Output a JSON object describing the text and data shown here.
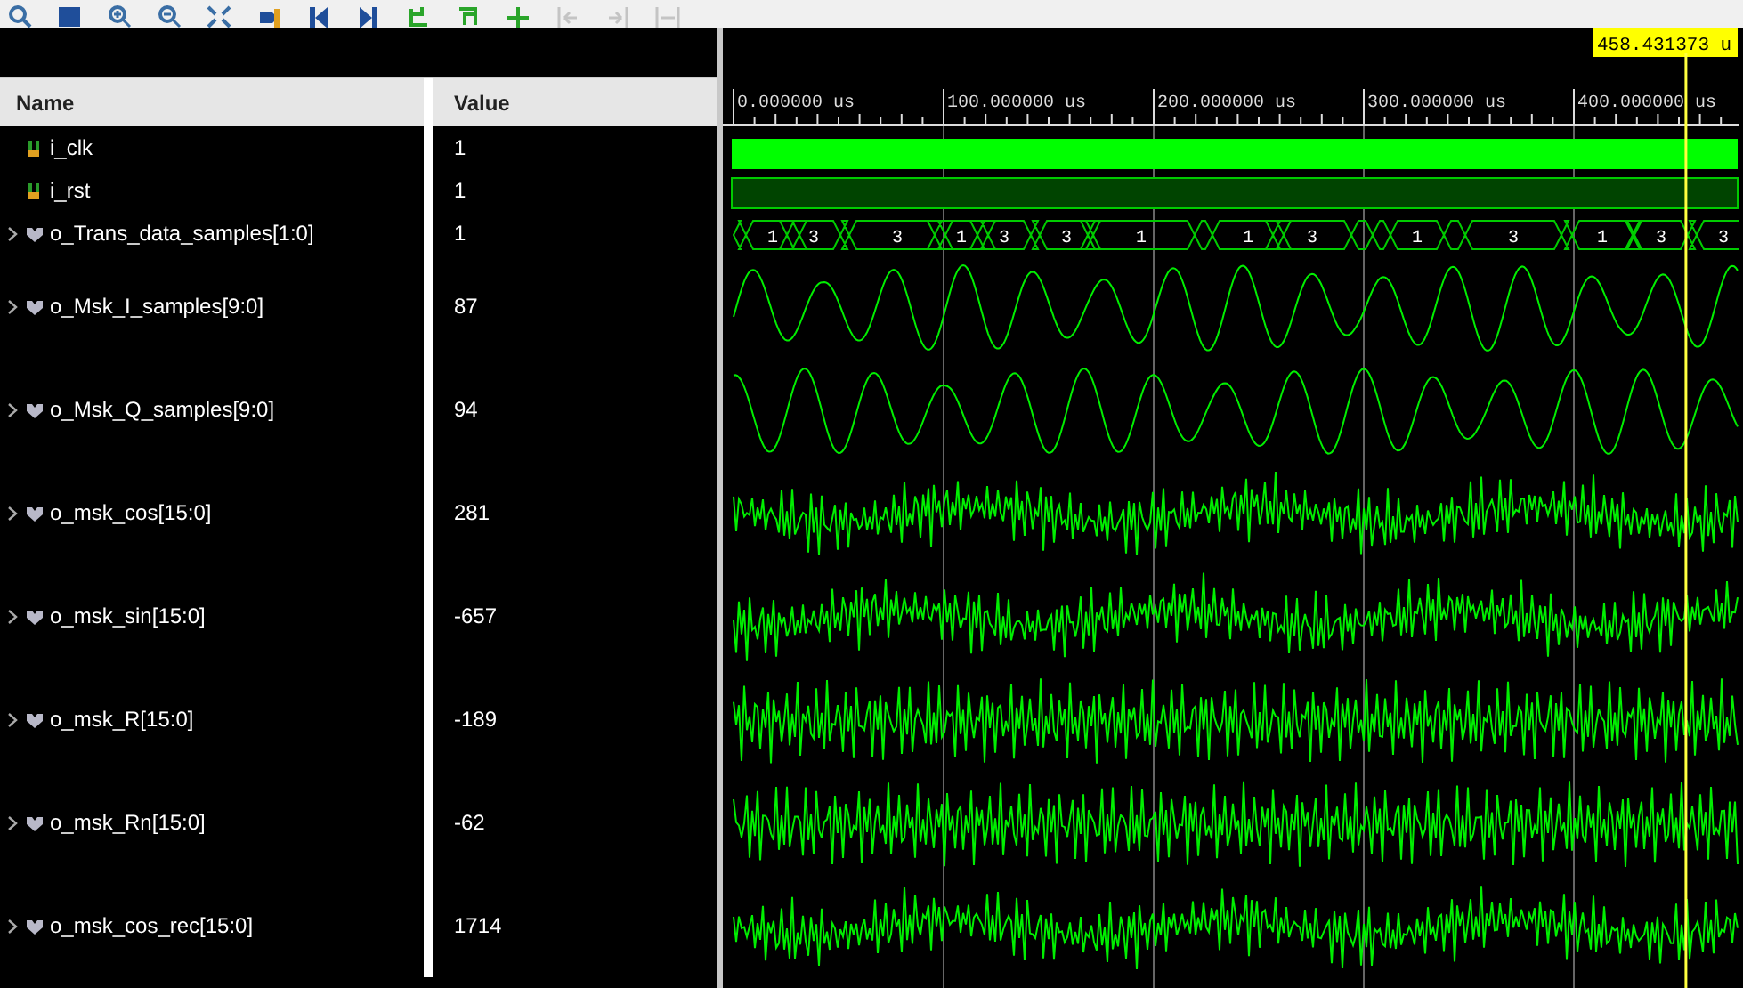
{
  "columns": {
    "name": "Name",
    "value": "Value"
  },
  "time_axis": {
    "labels": [
      "0.000000 us",
      "100.000000 us",
      "200.000000 us",
      "300.000000 us",
      "400.000000 us"
    ]
  },
  "cursor": {
    "label": "458.431373 u"
  },
  "signals": [
    {
      "name": "i_clk",
      "value": "1",
      "kind": "clock",
      "expandable": false
    },
    {
      "name": "i_rst",
      "value": "1",
      "kind": "level",
      "expandable": false
    },
    {
      "name": "o_Trans_data_samples[1:0]",
      "value": "1",
      "kind": "bus",
      "expandable": true,
      "segments": [
        "1",
        "3",
        "3",
        "1",
        "3",
        "3",
        "1",
        "1",
        "3",
        "1",
        "3",
        "1",
        "3",
        "3"
      ]
    },
    {
      "name": "o_Msk_I_samples[9:0]",
      "value": "87",
      "kind": "smooth",
      "expandable": true
    },
    {
      "name": "o_Msk_Q_samples[9:0]",
      "value": "94",
      "kind": "smooth",
      "expandable": true
    },
    {
      "name": "o_msk_cos[15:0]",
      "value": "281",
      "kind": "noisy",
      "expandable": true
    },
    {
      "name": "o_msk_sin[15:0]",
      "value": "-657",
      "kind": "noisy",
      "expandable": true
    },
    {
      "name": "o_msk_R[15:0]",
      "value": "-189",
      "kind": "dense",
      "expandable": true
    },
    {
      "name": "o_msk_Rn[15:0]",
      "value": "-62",
      "kind": "dense",
      "expandable": true
    },
    {
      "name": "o_msk_cos_rec[15:0]",
      "value": "1714",
      "kind": "noisy",
      "expandable": true
    }
  ]
}
